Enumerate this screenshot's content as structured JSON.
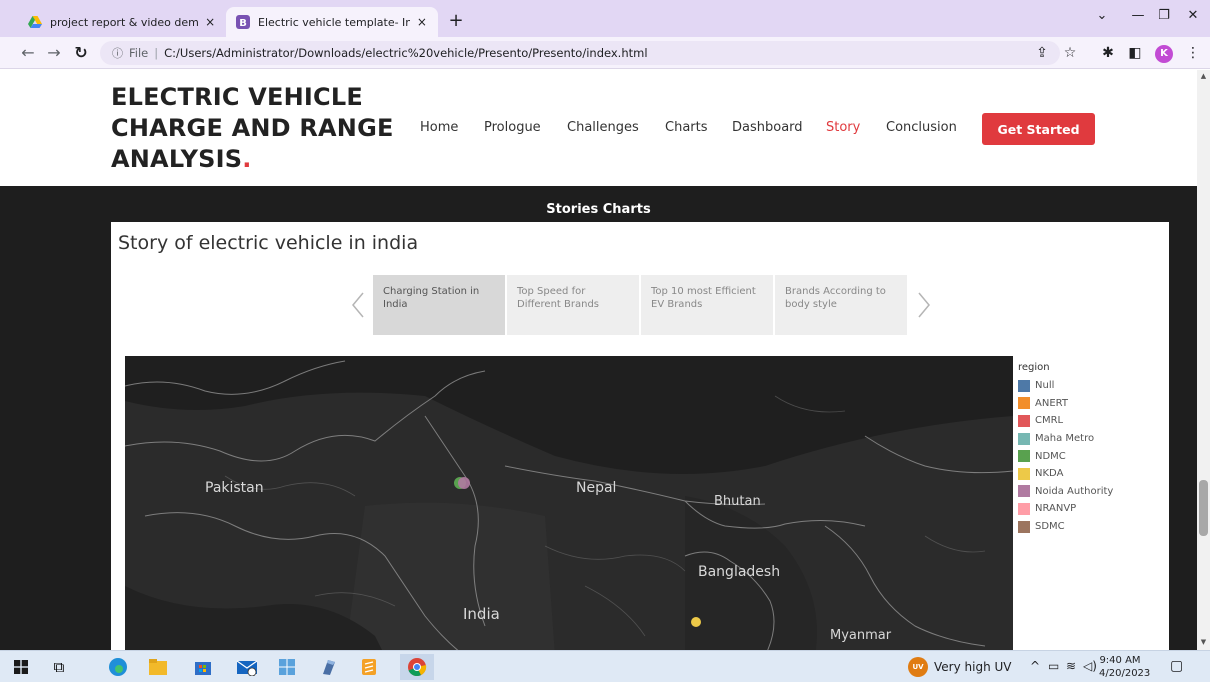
{
  "browser": {
    "tabs": [
      {
        "title": "project report & video demonstr",
        "active": false
      },
      {
        "title": "Electric vehicle template- Index",
        "active": true
      }
    ],
    "close_glyph": "×",
    "new_tab_glyph": "+",
    "url": {
      "info_glyph": "ⓘ",
      "file_label": "File",
      "separator": "|",
      "path": "C:/Users/Administrator/Downloads/electric%20vehicle/Presento/Presento/index.html"
    },
    "profile_initial": "K"
  },
  "site": {
    "logo_text_line1": "ELECTRIC VEHICLE",
    "logo_text_line2": "CHARGE AND RANGE",
    "logo_text_line3": "ANALYSIS",
    "logo_dot": ".",
    "nav": [
      {
        "label": "Home",
        "active": false
      },
      {
        "label": "Prologue",
        "active": false
      },
      {
        "label": "Challenges",
        "active": false
      },
      {
        "label": "Charts",
        "active": false
      },
      {
        "label": "Dashboard",
        "active": false
      },
      {
        "label": "Story",
        "active": true
      },
      {
        "label": "Conclusion",
        "active": false
      }
    ],
    "cta_label": "Get Started",
    "accent_color": "#e03a3e"
  },
  "section": {
    "title": "Stories Charts",
    "story_title": "Story of electric vehicle in india",
    "story_points": [
      {
        "label": "Charging Station in India",
        "selected": true
      },
      {
        "label": "Top Speed for Different Brands",
        "selected": false
      },
      {
        "label": "Top 10 most Efficient EV Brands",
        "selected": false
      },
      {
        "label": "Brands According to body style",
        "selected": false
      }
    ]
  },
  "map": {
    "labels": [
      "Pakistan",
      "Nepal",
      "Bhutan",
      "Bangladesh",
      "India",
      "Myanmar"
    ],
    "legend": {
      "title": "region",
      "items": [
        {
          "name": "Null",
          "color": "#4e79a7"
        },
        {
          "name": "ANERT",
          "color": "#f28e2b"
        },
        {
          "name": "CMRL",
          "color": "#e15759"
        },
        {
          "name": "Maha Metro",
          "color": "#76b7b2"
        },
        {
          "name": "NDMC",
          "color": "#59a14f"
        },
        {
          "name": "NKDA",
          "color": "#edc948"
        },
        {
          "name": "Noida Authority",
          "color": "#b07aa1"
        },
        {
          "name": "NRANVP",
          "color": "#ff9da7"
        },
        {
          "name": "SDMC",
          "color": "#9c755f"
        }
      ]
    }
  },
  "taskbar": {
    "weather_icon_text": "UV",
    "weather_text": "Very high UV",
    "time": "9:40 AM",
    "date": "4/20/2023"
  }
}
